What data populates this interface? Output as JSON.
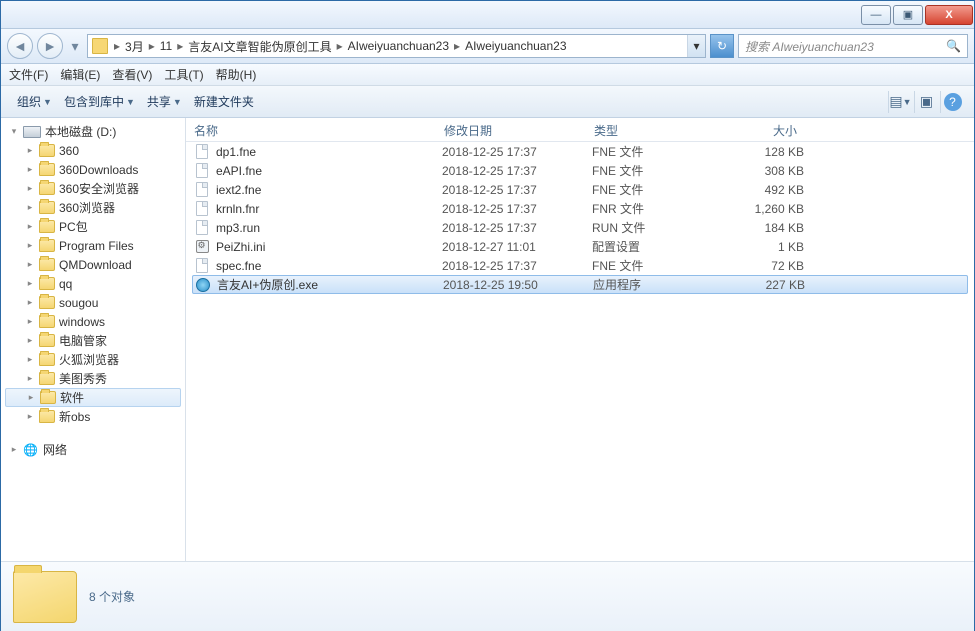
{
  "window": {
    "min": "—",
    "max": "▣",
    "close": "X"
  },
  "breadcrumb": [
    "3月",
    "11",
    "言友AI文章智能伪原创工具",
    "AIweiyuanchuan23",
    "AIweiyuanchuan23"
  ],
  "search": {
    "placeholder": "搜索 AIweiyuanchuan23"
  },
  "menu": {
    "file": "文件(F)",
    "edit": "编辑(E)",
    "view": "查看(V)",
    "tools": "工具(T)",
    "help": "帮助(H)"
  },
  "toolbar": {
    "organize": "组织",
    "include": "包含到库中",
    "share": "共享",
    "newfolder": "新建文件夹"
  },
  "columns": {
    "name": "名称",
    "date": "修改日期",
    "type": "类型",
    "size": "大小"
  },
  "tree": {
    "drive": "本地磁盘 (D:)",
    "items": [
      "360",
      "360Downloads",
      "360安全浏览器",
      "360浏览器",
      "PC包",
      "Program Files",
      "QMDownload",
      "qq",
      "sougou",
      "windows",
      "电脑管家",
      "火狐浏览器",
      "美图秀秀",
      "软件",
      "新obs"
    ],
    "selected": "软件",
    "network": "网络"
  },
  "files": [
    {
      "icon": "doc",
      "name": "dp1.fne",
      "date": "2018-12-25 17:37",
      "type": "FNE 文件",
      "size": "128 KB"
    },
    {
      "icon": "doc",
      "name": "eAPI.fne",
      "date": "2018-12-25 17:37",
      "type": "FNE 文件",
      "size": "308 KB"
    },
    {
      "icon": "doc",
      "name": "iext2.fne",
      "date": "2018-12-25 17:37",
      "type": "FNE 文件",
      "size": "492 KB"
    },
    {
      "icon": "doc",
      "name": "krnln.fnr",
      "date": "2018-12-25 17:37",
      "type": "FNR 文件",
      "size": "1,260 KB"
    },
    {
      "icon": "doc",
      "name": "mp3.run",
      "date": "2018-12-25 17:37",
      "type": "RUN 文件",
      "size": "184 KB"
    },
    {
      "icon": "ini",
      "name": "PeiZhi.ini",
      "date": "2018-12-27 11:01",
      "type": "配置设置",
      "size": "1 KB"
    },
    {
      "icon": "doc",
      "name": "spec.fne",
      "date": "2018-12-25 17:37",
      "type": "FNE 文件",
      "size": "72 KB"
    },
    {
      "icon": "exe",
      "name": "言友AI+伪原创.exe",
      "date": "2018-12-25 19:50",
      "type": "应用程序",
      "size": "227 KB",
      "selected": true
    }
  ],
  "status": {
    "count": "8 个对象"
  }
}
